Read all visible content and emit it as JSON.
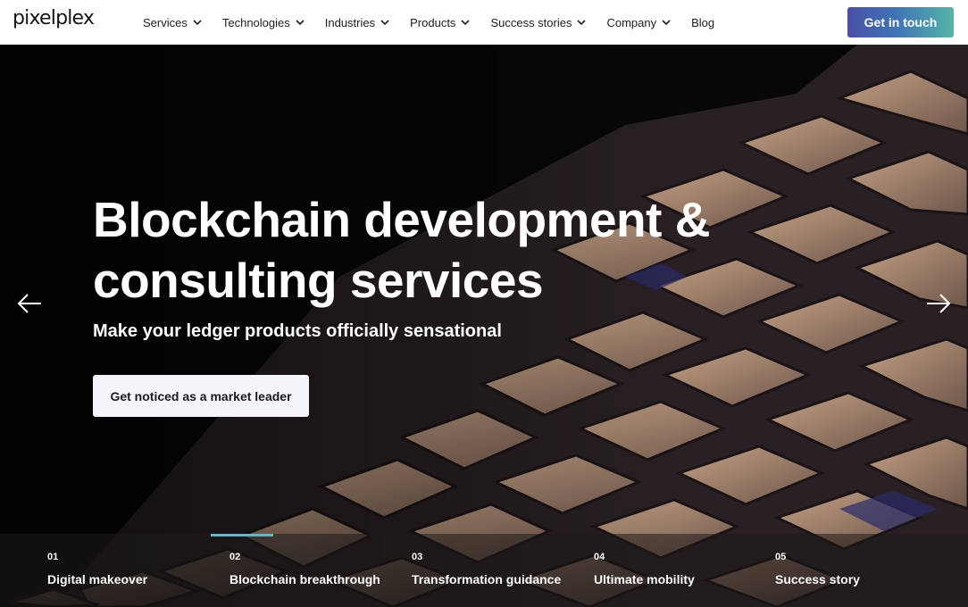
{
  "brand": {
    "logo": "pixelplex"
  },
  "nav": {
    "items": [
      {
        "label": "Services",
        "has_dropdown": true
      },
      {
        "label": "Technologies",
        "has_dropdown": true
      },
      {
        "label": "Industries",
        "has_dropdown": true
      },
      {
        "label": "Products",
        "has_dropdown": true
      },
      {
        "label": "Success stories",
        "has_dropdown": true
      },
      {
        "label": "Company",
        "has_dropdown": true
      },
      {
        "label": "Blog",
        "has_dropdown": false
      }
    ],
    "cta_label": "Get in touch"
  },
  "hero": {
    "title_line1": "Blockchain development &",
    "title_line2": "consulting services",
    "subtitle": "Make your ledger products officially sensational",
    "button_label": "Get noticed as a market leader",
    "prev_icon": "arrow-left-icon",
    "next_icon": "arrow-right-icon"
  },
  "slides": [
    {
      "num": "01",
      "label": "Digital makeover"
    },
    {
      "num": "02",
      "label": "Blockchain breakthrough",
      "active": true
    },
    {
      "num": "03",
      "label": "Transformation guidance"
    },
    {
      "num": "04",
      "label": "Ultimate mobility"
    },
    {
      "num": "05",
      "label": "Success story"
    }
  ],
  "colors": {
    "cta_gradient_start": "#4a4fa6",
    "cta_gradient_end": "#55b6a8",
    "progress": "#5eb8c7",
    "hero_button_bg": "#f4f5f9"
  }
}
